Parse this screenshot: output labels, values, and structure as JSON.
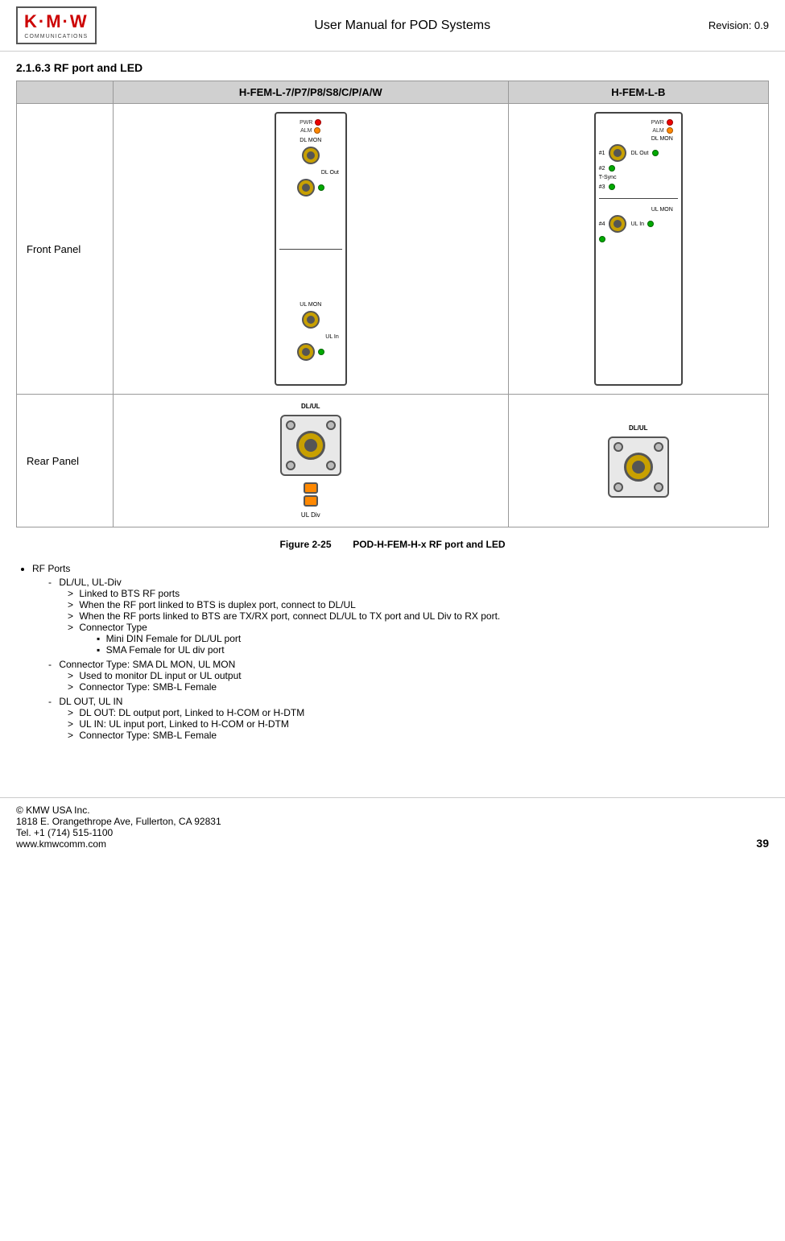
{
  "header": {
    "logo_kmw": "K·M·W",
    "logo_sub": "COMMUNICATIONS",
    "title": "User Manual for POD Systems",
    "revision": "Revision: 0.9"
  },
  "section": {
    "heading": "2.1.6.3   RF port and LED"
  },
  "table": {
    "col1_header": "",
    "col2_header": "H-FEM-L-7/P7/P8/S8/C/P/A/W",
    "col3_header": "H-FEM-L-B",
    "row1_label": "Front Panel",
    "row2_label": "Rear Panel"
  },
  "left_front_panel": {
    "pwr_label": "PWR",
    "alm_label": "ALM",
    "dl_mon_label": "DL MON",
    "dl_out_label": "DL Out",
    "ul_mon_label": "UL MON",
    "ul_in_label": "UL In"
  },
  "right_front_panel": {
    "pwr_label": "PWR",
    "alm_label": "ALM",
    "dl_mon_label": "DL MON",
    "dl_out_label": "DL Out",
    "label_1": "#1",
    "label_2": "#2",
    "t_sync_label": "T-Sync",
    "label_3": "#3",
    "ul_mon_label": "UL MON",
    "label_4": "#4",
    "ul_in_label": "UL In"
  },
  "left_rear_panel": {
    "dl_ul_label": "DL/UL",
    "ul_div_label": "UL Div"
  },
  "right_rear_panel": {
    "dl_ul_label": "DL/UL"
  },
  "figure": {
    "label": "Figure 2-25",
    "caption": "POD-H-FEM-H-x RF port and LED"
  },
  "bullets": {
    "main_item": "RF Ports",
    "sub_items": [
      {
        "label": "DL/UL, UL-Div",
        "children": [
          "Linked  to BTS RF ports",
          "When the RF port linked to BTS is duplex port, connect to DL/UL",
          "When the RF ports linked to BTS are TX/RX port, connect DL/UL to TX port and UL Div to RX port.",
          "Connector Type"
        ],
        "connector_types": [
          "Mini DIN Female for DL/UL port",
          "SMA Female for UL div port"
        ]
      },
      {
        "label": "Connector Type: SMA DL MON, UL MON",
        "children": [
          "Used to monitor DL input or UL output",
          "Connector Type: SMB-L Female"
        ]
      },
      {
        "label": "DL OUT, UL IN",
        "children": [
          "DL OUT: DL output port, Linked to H-COM or H-DTM",
          "UL IN: UL input port, Linked to H-COM or H-DTM",
          "Connector Type: SMB-L Female"
        ]
      }
    ]
  },
  "footer": {
    "company": "© KMW USA Inc.",
    "address": "1818 E. Orangethrope Ave, Fullerton, CA 92831",
    "tel": "Tel. +1 (714) 515-1100",
    "website": "www.kmwcomm.com",
    "page": "39"
  }
}
